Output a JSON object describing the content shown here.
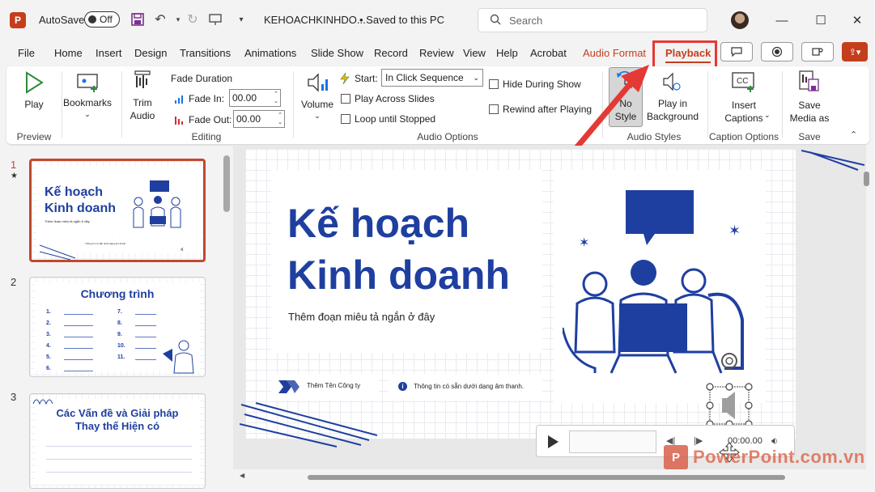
{
  "titlebar": {
    "app_icon": "P",
    "autosave_label": "AutoSave",
    "autosave_state": "Off",
    "doc_title": "KEHOACHKINHDO...",
    "doc_status": "• Saved to this PC",
    "search_placeholder": "Search"
  },
  "tabs": [
    "File",
    "Home",
    "Insert",
    "Design",
    "Transitions",
    "Animations",
    "Slide Show",
    "Record",
    "Review",
    "View",
    "Help",
    "Acrobat",
    "Audio Format",
    "Playback"
  ],
  "ribbon": {
    "preview": {
      "play": "Play",
      "group": "Preview"
    },
    "bookmarks": {
      "label": "Bookmarks"
    },
    "editing": {
      "trim_line1": "Trim",
      "trim_line2": "Audio",
      "fade_duration": "Fade Duration",
      "fade_in_label": "Fade In:",
      "fade_in_value": "00.00",
      "fade_out_label": "Fade Out:",
      "fade_out_value": "00.00",
      "group": "Editing"
    },
    "audio_options": {
      "volume": "Volume",
      "start_label": "Start:",
      "start_value": "In Click Sequence",
      "play_across": "Play Across Slides",
      "loop": "Loop until Stopped",
      "hide": "Hide During Show",
      "rewind": "Rewind after Playing",
      "group": "Audio Options"
    },
    "audio_styles": {
      "no_style_1": "No",
      "no_style_2": "Style",
      "bg_1": "Play in",
      "bg_2": "Background",
      "group": "Audio Styles"
    },
    "captions": {
      "line1": "Insert",
      "line2": "Captions",
      "group": "Caption Options"
    },
    "save": {
      "line1": "Save",
      "line2": "Media as",
      "group": "Save"
    }
  },
  "slides_panel": {
    "numbers": [
      "1",
      "2",
      "3"
    ],
    "slide1": {
      "title_1": "Kế hoạch",
      "title_2": "Kinh doanh",
      "sub": "Thêm đoạn miêu tả ngắn ở đây",
      "info": "Thông tin có sẵn dưới dạng âm thanh."
    },
    "slide2": {
      "title": "Chương trình",
      "nums_left": [
        "1.",
        "2.",
        "3.",
        "4.",
        "5.",
        "6."
      ],
      "nums_right": [
        "7.",
        "8.",
        "9.",
        "10.",
        "11."
      ]
    },
    "slide3": {
      "title_1": "Các Vấn đề và Giải pháp",
      "title_2": "Thay thế Hiện có"
    }
  },
  "slide": {
    "title_1": "Kế hoạch",
    "title_2": "Kinh doanh",
    "subtitle": "Thêm đoạn miêu tả ngắn ở đây",
    "company": "Thêm Tên Công ty",
    "info": "Thông tin có sẵn dưới dạng âm thanh.",
    "info_icon": "i"
  },
  "player": {
    "time": "00:00.00"
  },
  "watermark": {
    "logo": "P",
    "text": "PowerPoint.com.vn"
  },
  "colors": {
    "accent": "#c43e1c",
    "highlight": "#e53935",
    "slide_blue": "#1f3fa0"
  }
}
